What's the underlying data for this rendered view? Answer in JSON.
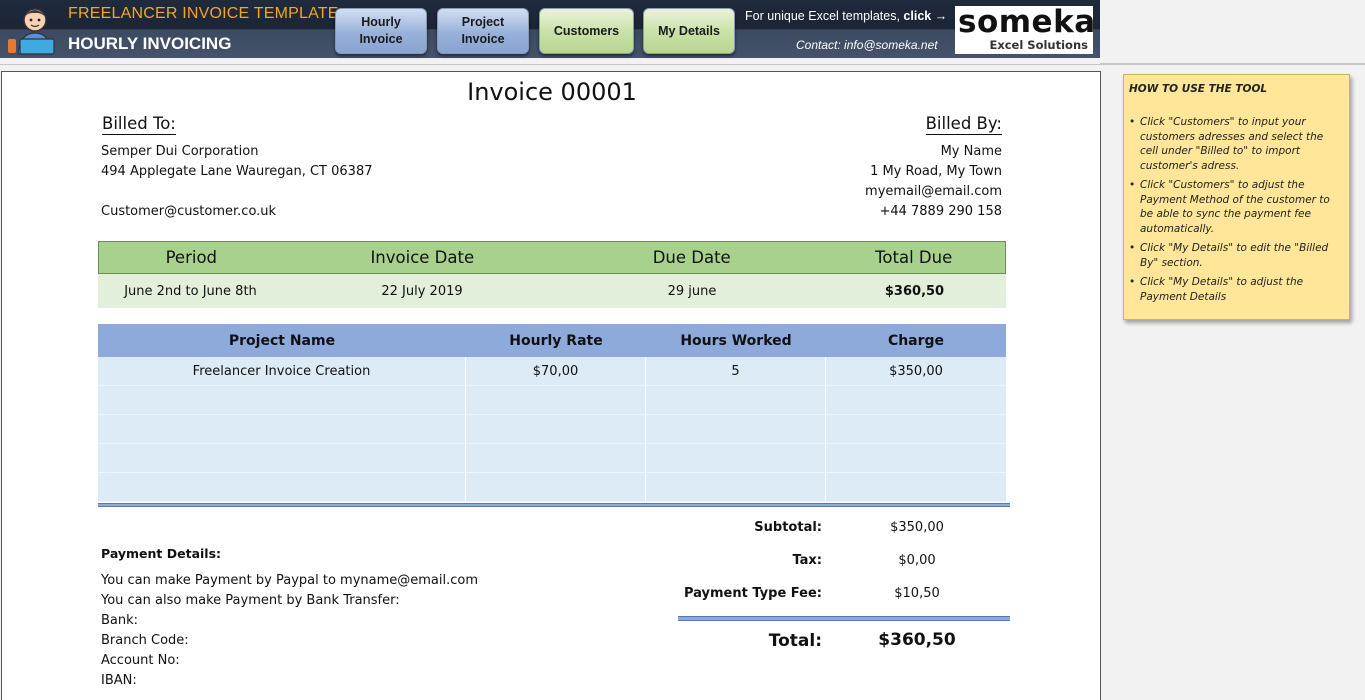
{
  "header": {
    "app_title": "FREELANCER INVOICE TEMPLATE",
    "app_subtitle": "HOURLY INVOICING",
    "nav": [
      {
        "label": "Hourly\nInvoice",
        "style": "blue"
      },
      {
        "label": "Project\nInvoice",
        "style": "blue"
      },
      {
        "label": "Customers",
        "style": "green"
      },
      {
        "label": "My Details",
        "style": "green"
      }
    ],
    "promo_text": "For unique Excel templates, ",
    "promo_click": "click →",
    "contact": "Contact: info@someka.net",
    "logo_word": "someka",
    "logo_sub": "Excel Solutions"
  },
  "invoice": {
    "title": "Invoice 00001",
    "billed_to_label": "Billed To:",
    "billed_by_label": "Billed By:",
    "billed_to": {
      "name": "Semper Dui Corporation",
      "address": "494 Applegate Lane Wauregan, CT 06387",
      "email": "Customer@customer.co.uk"
    },
    "billed_by": {
      "name": "My Name",
      "address": "1 My Road, My Town",
      "email": "myemail@email.com",
      "phone": "+44 7889 290 158"
    },
    "summary": {
      "headers": [
        "Period",
        "Invoice Date",
        "Due Date",
        "Total Due"
      ],
      "values": [
        "June 2nd to June 8th",
        "22 July 2019",
        "29 june",
        "$360,50"
      ]
    },
    "projects": {
      "headers": [
        "Project Name",
        "Hourly Rate",
        "Hours Worked",
        "Charge"
      ],
      "rows": [
        [
          "Freelancer Invoice Creation",
          "$70,00",
          "5",
          "$350,00"
        ],
        [
          "",
          "",
          "",
          ""
        ],
        [
          "",
          "",
          "",
          ""
        ],
        [
          "",
          "",
          "",
          ""
        ],
        [
          "",
          "",
          "",
          ""
        ]
      ]
    },
    "totals": {
      "subtotal_label": "Subtotal:",
      "subtotal": "$350,00",
      "tax_label": "Tax:",
      "tax": "$0,00",
      "fee_label": "Payment Type Fee:",
      "fee": "$10,50",
      "total_label": "Total:",
      "total": "$360,50"
    },
    "payment": {
      "title": "Payment Details:",
      "lines": [
        "You can make Payment by Paypal to myname@email.com",
        "You can also make Payment by Bank Transfer:",
        "Bank:",
        "Branch Code:",
        "Account No:",
        "IBAN:"
      ]
    }
  },
  "help": {
    "title": "HOW TO USE THE TOOL",
    "items": [
      "Click \"Customers\" to input your customers adresses and select the cell under \"Billed to\" to import customer's adress.",
      "Click \"Customers\" to adjust the Payment Method of the customer to be able to sync the payment fee automatically.",
      "Click \"My Details\" to edit the \"Billed By\" section.",
      "Click \"My Details\" to adjust the Payment Details"
    ]
  }
}
